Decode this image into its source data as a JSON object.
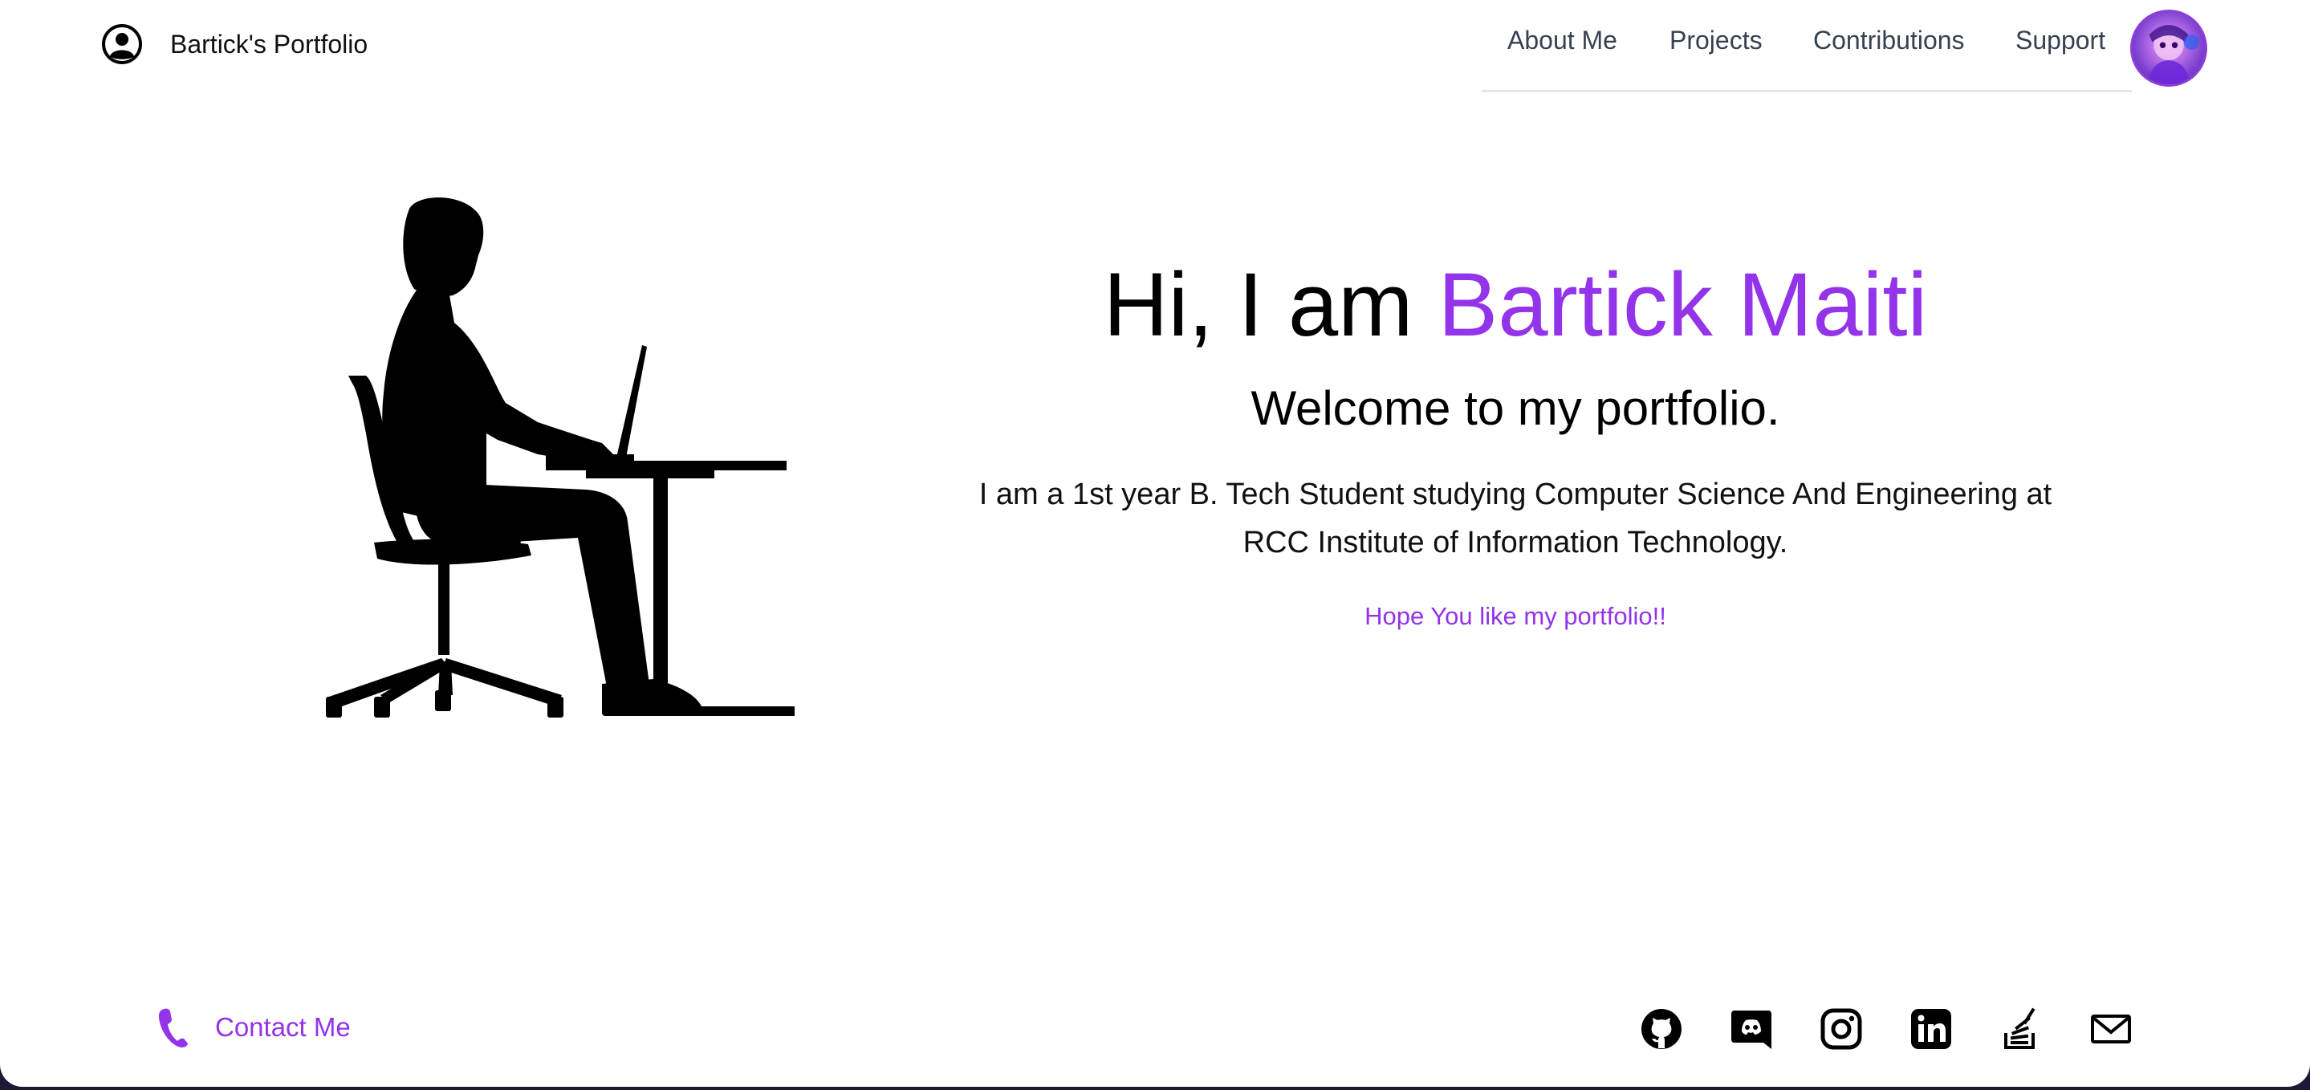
{
  "header": {
    "brand": {
      "icon": "user-circle-icon",
      "title": "Bartick's Portfolio"
    },
    "nav": [
      {
        "label": "About Me"
      },
      {
        "label": "Projects"
      },
      {
        "label": "Contributions"
      },
      {
        "label": "Support"
      }
    ],
    "avatar": {
      "icon": "avatar"
    }
  },
  "hero": {
    "illustration": "person-at-desk-silhouette",
    "greeting": "Hi, I am ",
    "name": "Bartick Maiti",
    "subtitle": "Welcome to my portfolio.",
    "bio": "I am a 1st year B. Tech Student studying Computer Science And Engineering at RCC Institute of Information Technology.",
    "note": "Hope You like my portfolio!!"
  },
  "footer": {
    "contact": {
      "icon": "phone-icon",
      "label": "Contact Me"
    },
    "socials": [
      {
        "icon": "github-icon"
      },
      {
        "icon": "discord-icon"
      },
      {
        "icon": "instagram-icon"
      },
      {
        "icon": "linkedin-icon"
      },
      {
        "icon": "stackoverflow-icon"
      },
      {
        "icon": "mail-icon"
      }
    ]
  },
  "colors": {
    "accent": "#9333ea",
    "text": "#000000",
    "nav_text": "#374151",
    "background": "#ffffff"
  }
}
